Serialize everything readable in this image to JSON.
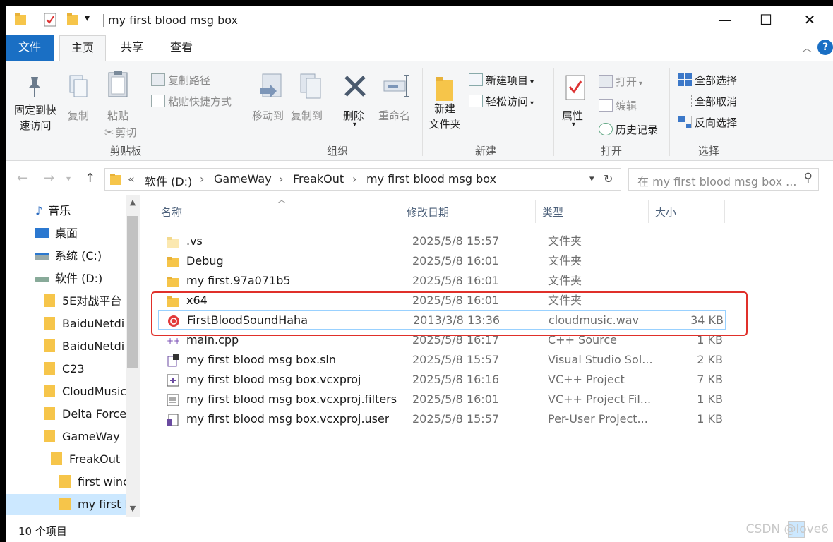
{
  "window": {
    "title": "my first blood msg box",
    "qa_dropdown": "▾",
    "minimize": "—",
    "maximize": "☐",
    "close": "✕"
  },
  "tabs": {
    "file": "文件",
    "home": "主页",
    "share": "共享",
    "view": "查看"
  },
  "ribbon": {
    "clipboard": {
      "pin": "固定到快\n速访问",
      "pin_line1": "固定到快",
      "pin_line2": "速访问",
      "copy": "复制",
      "paste": "粘贴",
      "copy_path": "复制路径",
      "paste_shortcut": "粘贴快捷方式",
      "cut": "剪切",
      "group": "剪贴板"
    },
    "organize": {
      "move_to": "移动到",
      "copy_to": "复制到",
      "delete": "删除",
      "rename": "重命名",
      "group": "组织"
    },
    "new": {
      "new_folder_l1": "新建",
      "new_folder_l2": "文件夹",
      "new_item": "新建项目",
      "easy_access": "轻松访问",
      "group": "新建"
    },
    "open": {
      "properties": "属性",
      "open": "打开",
      "edit": "编辑",
      "history": "历史记录",
      "group": "打开"
    },
    "select": {
      "select_all": "全部选择",
      "select_none": "全部取消",
      "invert": "反向选择",
      "group": "选择"
    }
  },
  "address": {
    "overflow": "«",
    "crumbs": [
      "软件 (D:)",
      "GameWay",
      "FreakOut",
      "my first blood msg box"
    ],
    "sep": "›",
    "search_placeholder": "在 my first blood msg box ..."
  },
  "nav": {
    "items": [
      {
        "label": "音乐"
      },
      {
        "label": "桌面"
      },
      {
        "label": "系统 (C:)"
      },
      {
        "label": "软件 (D:)"
      },
      {
        "label": "5E对战平台"
      },
      {
        "label": "BaiduNetdi"
      },
      {
        "label": "BaiduNetdi"
      },
      {
        "label": "C23"
      },
      {
        "label": "CloudMusic"
      },
      {
        "label": "Delta Force"
      },
      {
        "label": "GameWay"
      },
      {
        "label": "FreakOut"
      },
      {
        "label": "first winc"
      },
      {
        "label": "my first b"
      }
    ]
  },
  "columns": {
    "name": "名称",
    "date": "修改日期",
    "type": "类型",
    "size": "大小"
  },
  "files": [
    {
      "name": ".vs",
      "date": "2025/5/8 15:57",
      "type": "文件夹",
      "size": "",
      "icon": "folder-light-icon"
    },
    {
      "name": "Debug",
      "date": "2025/5/8 16:01",
      "type": "文件夹",
      "size": "",
      "icon": "folder-icon"
    },
    {
      "name": "my first.97a071b5",
      "date": "2025/5/8 16:01",
      "type": "文件夹",
      "size": "",
      "icon": "folder-icon"
    },
    {
      "name": "x64",
      "date": "2025/5/8 16:01",
      "type": "文件夹",
      "size": "",
      "icon": "folder-icon"
    },
    {
      "name": "FirstBloodSoundHaha",
      "date": "2013/3/8 13:36",
      "type": "cloudmusic.wav",
      "size": "34 KB",
      "icon": "cloudmusic-icon"
    },
    {
      "name": "main.cpp",
      "date": "2025/5/8 16:17",
      "type": "C++ Source",
      "size": "1 KB",
      "icon": "cpp-file-icon"
    },
    {
      "name": "my first blood msg box.sln",
      "date": "2025/5/8 15:57",
      "type": "Visual Studio Sol...",
      "size": "2 KB",
      "icon": "sln-file-icon"
    },
    {
      "name": "my first blood msg box.vcxproj",
      "date": "2025/5/8 16:16",
      "type": "VC++ Project",
      "size": "7 KB",
      "icon": "vcxproj-file-icon"
    },
    {
      "name": "my first blood msg box.vcxproj.filters",
      "date": "2025/5/8 16:01",
      "type": "VC++ Project Fil...",
      "size": "1 KB",
      "icon": "filters-file-icon"
    },
    {
      "name": "my first blood msg box.vcxproj.user",
      "date": "2025/5/8 15:57",
      "type": "Per-User Project...",
      "size": "1 KB",
      "icon": "user-file-icon"
    }
  ],
  "status": {
    "count": "10 个项目"
  },
  "watermark": "CSDN @love6",
  "colors": {
    "accent": "#1a6fc4",
    "folder": "#f6c54a",
    "highlight": "#e0302a",
    "selected": "#cce8ff"
  }
}
